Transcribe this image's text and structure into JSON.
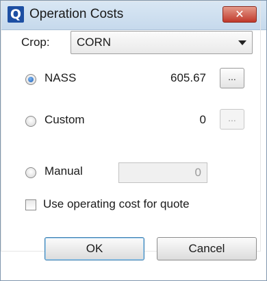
{
  "window": {
    "title": "Operation Costs",
    "icon_letter": "Q",
    "close_glyph": "✕"
  },
  "crop": {
    "label": "Crop:",
    "selected": "CORN"
  },
  "options": [
    {
      "label": "NASS",
      "value": "605.67",
      "checked": true,
      "button": "...",
      "button_enabled": true
    },
    {
      "label": "Custom",
      "value": "0",
      "checked": false,
      "button": "...",
      "button_enabled": false
    },
    {
      "label": "Manual",
      "value": "0",
      "checked": false
    }
  ],
  "use_operating_cost": {
    "label": "Use operating cost for quote",
    "checked": false
  },
  "buttons": {
    "ok": "OK",
    "cancel": "Cancel"
  }
}
